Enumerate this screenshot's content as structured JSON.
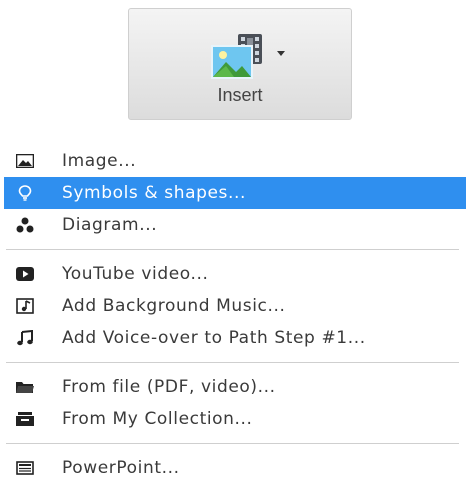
{
  "toolbar": {
    "insert_label": "Insert",
    "insert_icon": "image-video-icon",
    "dropdown_icon": "caret-down-icon"
  },
  "menu": {
    "groups": [
      {
        "items": [
          {
            "label": "Image...",
            "icon": "image-icon",
            "selected": false
          },
          {
            "label": "Symbols & shapes...",
            "icon": "lightbulb-icon",
            "selected": true
          },
          {
            "label": "Diagram...",
            "icon": "diagram-icon",
            "selected": false
          }
        ]
      },
      {
        "items": [
          {
            "label": "YouTube video...",
            "icon": "youtube-icon",
            "selected": false
          },
          {
            "label": "Add Background Music...",
            "icon": "music-file-icon",
            "selected": false
          },
          {
            "label": "Add Voice-over to Path Step #1...",
            "icon": "music-note-icon",
            "selected": false
          }
        ]
      },
      {
        "items": [
          {
            "label": "From file (PDF, video)...",
            "icon": "folder-icon",
            "selected": false
          },
          {
            "label": "From My Collection...",
            "icon": "collection-icon",
            "selected": false
          }
        ]
      },
      {
        "items": [
          {
            "label": "PowerPoint...",
            "icon": "powerpoint-icon",
            "selected": false
          }
        ]
      }
    ]
  },
  "colors": {
    "selection": "#2f8fef",
    "text": "#3a3a3a",
    "separator": "#cfcfcf",
    "icon": "#222222"
  }
}
